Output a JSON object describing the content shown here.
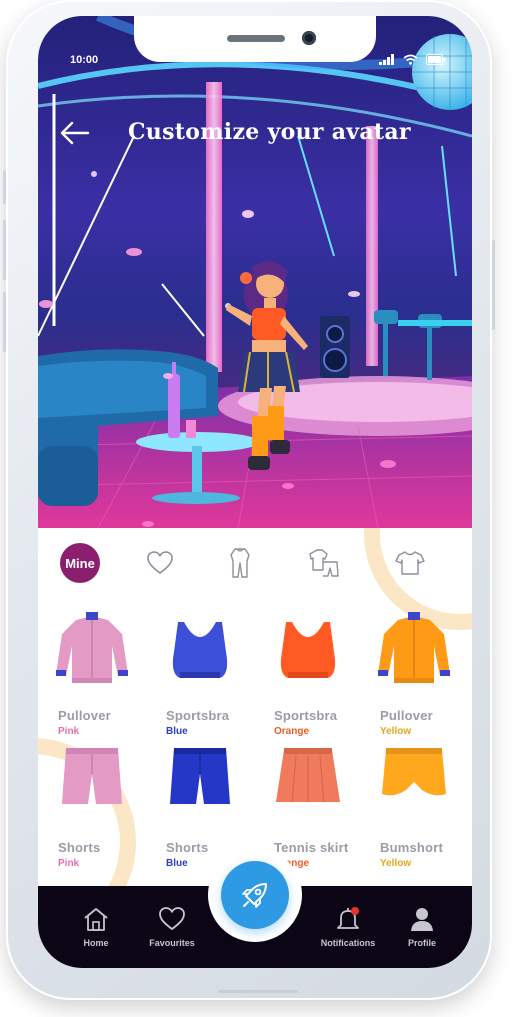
{
  "status_bar": {
    "time": "10:00"
  },
  "header": {
    "title": "Customize your avatar"
  },
  "category_tabs": [
    {
      "label": "Mine",
      "active": true
    },
    {
      "icon": "heart-icon"
    },
    {
      "icon": "jumpsuit-icon"
    },
    {
      "icon": "outfit-icon"
    },
    {
      "icon": "tshirt-icon"
    }
  ],
  "items": [
    {
      "name": "Pullover",
      "color_label": "Pink",
      "swatch": "#e39ac4",
      "label_color": "#e56fae"
    },
    {
      "name": "Sportsbra",
      "color_label": "Blue",
      "swatch": "#3c4fd8",
      "label_color": "#2c3dc9"
    },
    {
      "name": "Sportsbra",
      "color_label": "Orange",
      "swatch": "#ff5a24",
      "label_color": "#f05a22"
    },
    {
      "name": "Pullover",
      "color_label": "Yellow",
      "swatch": "#ff9a16",
      "label_color": "#e6a71a"
    },
    {
      "name": "Shorts",
      "color_label": "Pink",
      "swatch": "#e39ac4",
      "label_color": "#e56fae"
    },
    {
      "name": "Shorts",
      "color_label": "Blue",
      "swatch": "#2437c7",
      "label_color": "#2c3dc9"
    },
    {
      "name": "Tennis  skirt",
      "color_label": "Orange",
      "swatch": "#f07a5c",
      "label_color": "#f05a22"
    },
    {
      "name": "Bumshort",
      "color_label": "Yellow",
      "swatch": "#ffa81e",
      "label_color": "#e6a71a"
    }
  ],
  "bottom_nav": [
    {
      "label": "Home",
      "icon": "home-icon"
    },
    {
      "label": "Favourites",
      "icon": "heart-icon"
    },
    {
      "label": "Notifications",
      "icon": "bell-icon"
    },
    {
      "label": "Profile",
      "icon": "profile-icon"
    }
  ],
  "fab": {
    "icon": "rocket-icon"
  },
  "colors": {
    "accent": "#8b1f6e",
    "fab": "#2f9ae4",
    "nav_bg": "#0c0515"
  }
}
